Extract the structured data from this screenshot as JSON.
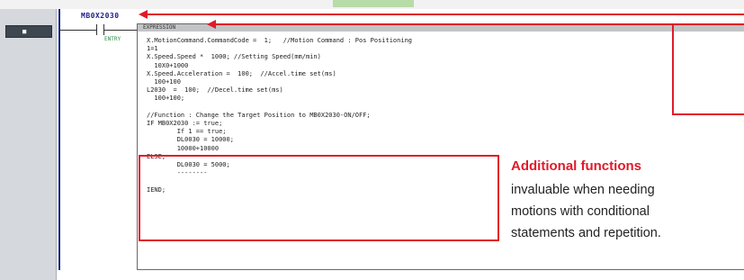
{
  "gutter": {
    "button_label": "■"
  },
  "ladder": {
    "contact_address": "MB0X2030",
    "contact_comment": "ENTRY",
    "st_header": "EXPRESSION"
  },
  "code_lines": [
    "X.MotionCommand.CommandCode =  1;   //Motion Command : Pos Positioning",
    "1=1",
    "X.Speed.Speed *  1000; //Setting Speed(mm/min)",
    "  10X0+1000",
    "X.Speed.Acceleration =  100;  //Accel.time set(ms)",
    "  100+100",
    "L2030  =  100;  //Decel.time set(ms)",
    "  100+100;",
    "",
    "//Function : Change the Target Position to MB0X2030-ON/OFF;",
    "IF MB0X2030 := true;",
    "        If 1 == true;",
    "        DL0030 = 10000;",
    "        10000+10000",
    "ELSE;",
    "        DL0030 = 5000;",
    "        --------",
    "",
    "IEND;"
  ],
  "callout": {
    "title": "Additional functions",
    "lines": [
      "invaluable when needing",
      "motions with conditional",
      "statements and repetition."
    ]
  }
}
